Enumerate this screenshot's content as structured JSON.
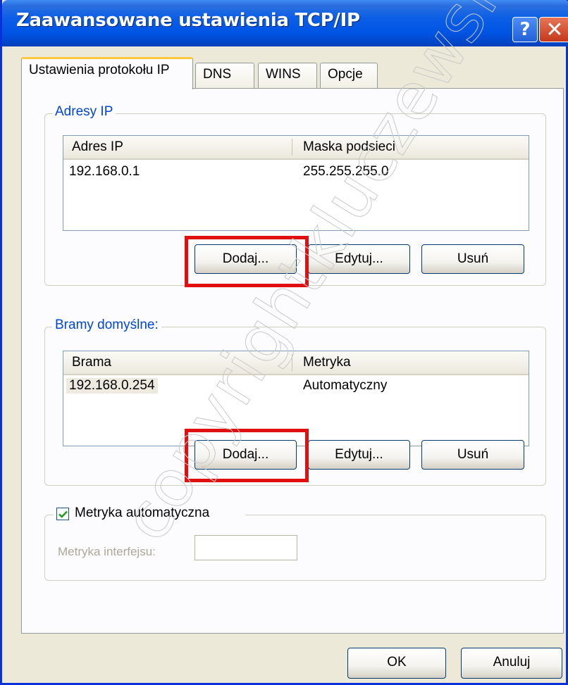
{
  "window": {
    "title": "Zaawansowane ustawienia TCP/IP",
    "help_glyph": "?",
    "close_glyph": "✕"
  },
  "tabs": [
    {
      "label": "Ustawienia protokołu IP",
      "active": true
    },
    {
      "label": "DNS",
      "active": false
    },
    {
      "label": "WINS",
      "active": false
    },
    {
      "label": "Opcje",
      "active": false
    }
  ],
  "ip_group": {
    "label": "Adresy IP",
    "columns": [
      "Adres IP",
      "Maska podsieci"
    ],
    "rows": [
      [
        "192.168.0.1",
        "255.255.255.0"
      ]
    ],
    "buttons": {
      "add": "Dodaj...",
      "edit": "Edytuj...",
      "remove": "Usuń"
    }
  },
  "gateway_group": {
    "label": "Bramy domyślne:",
    "columns": [
      "Brama",
      "Metryka"
    ],
    "rows": [
      [
        "192.168.0.254",
        "Automatyczny"
      ]
    ],
    "buttons": {
      "add": "Dodaj...",
      "edit": "Edytuj...",
      "remove": "Usuń"
    }
  },
  "metric_group": {
    "checkbox_label": "Metryka automatyczna",
    "checked": true,
    "interface_metric_label": "Metryka interfejsu:",
    "interface_metric_value": ""
  },
  "footer": {
    "ok": "OK",
    "cancel": "Anuluj"
  },
  "watermark": "copyrightkluczewski",
  "colors": {
    "titlebar": "#0054e3",
    "group_label": "#0046d5",
    "highlight": "#e01010",
    "tab_active_accent": "#ffc83c"
  }
}
